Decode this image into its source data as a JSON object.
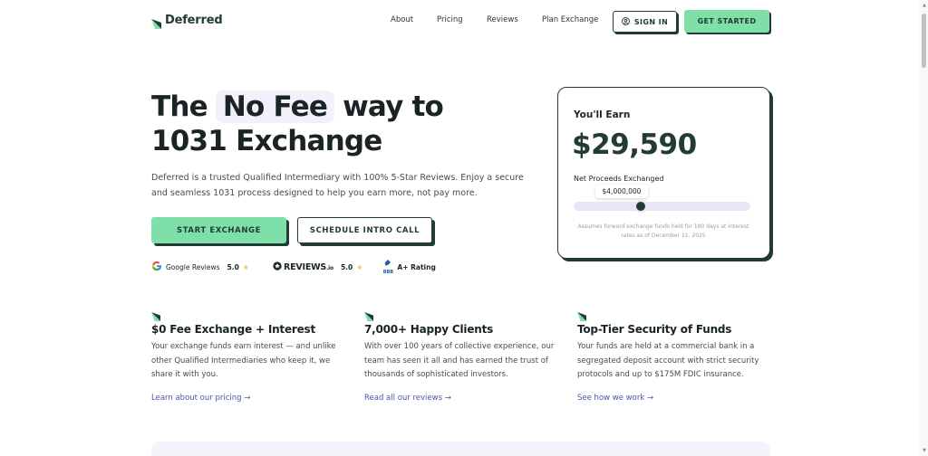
{
  "header": {
    "logo": "Deferred",
    "nav": [
      "About",
      "Pricing",
      "Reviews",
      "Plan Exchange"
    ],
    "sign_in": "SIGN IN",
    "get_started": "GET STARTED"
  },
  "hero": {
    "title_pre": "The",
    "title_highlight": "No Fee",
    "title_post": "way to",
    "title_line2": "1031 Exchange",
    "subtitle": "Deferred is a trusted Qualified Intermediary with 100% 5-Star Reviews. Enjoy a secure and seamless 1031 process designed to help you earn more, not pay more.",
    "start_button": "START EXCHANGE",
    "intro_button": "SCHEDULE INTRO CALL"
  },
  "ratings": {
    "google_label": "Google Reviews",
    "google_score": "5.0",
    "reviews_label": "REVIEWS",
    "reviews_suffix": ".io",
    "reviews_score": "5.0",
    "bbb_label": "BBB",
    "bbb_rating": "A+ Rating"
  },
  "earn_card": {
    "label": "You'll Earn",
    "amount": "$29,590",
    "net_label": "Net Proceeds Exchanged",
    "slider_value": "$4,000,000",
    "slider_fraction": 0.13,
    "note": "Assumes forward exchange funds held for 180 days at interest rates as of December 11, 2025"
  },
  "features": [
    {
      "title": "$0 Fee Exchange + Interest",
      "body": "Your exchange funds earn interest — and unlike other Qualified Intermediaries who keep it, we share it with you.",
      "link": "Learn about our pricing →"
    },
    {
      "title": "7,000+ Happy Clients",
      "body": "With over 100 years of collective experience, our team has seen it all and has earned the trust of thousands of sophisticated investors.",
      "link": "Read all our reviews →"
    },
    {
      "title": "Top-Tier Security of Funds",
      "body": "Your funds are held at a commercial bank in a segregated deposit account with strict security protocols and up to $175M FDIC insurance.",
      "link": "See how we work →"
    }
  ],
  "colors": {
    "brand_dark": "#233b35",
    "brand_green": "#7ee0a8",
    "link": "#4a55b3",
    "highlight_bg": "#f2f1fb"
  }
}
